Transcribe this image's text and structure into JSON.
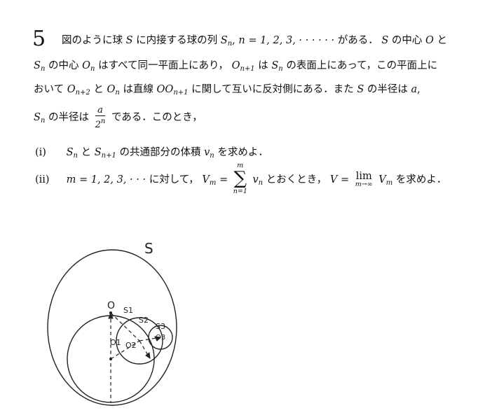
{
  "problem_number": "5",
  "p1": {
    "t1": "図のように球",
    "S": "S",
    "t2": "に内接する球の列",
    "Sn": "S",
    "n_sub": "n",
    "t3": ",",
    "seq": "n = 1, 2, 3, · · · · · ·",
    "t4": "がある．",
    "t5": "の中心",
    "O": "O",
    "t6": "と"
  },
  "p2": {
    "Sn": "S",
    "n": "n",
    "t1": "の中心",
    "On": "O",
    "t2": "はすべて同一平面上にあり，",
    "On1": "O",
    "n1": "n+1",
    "t3": "は",
    "t4": "の表面上にあって，この平面上に"
  },
  "p3": {
    "t1": "おいて",
    "On2": "O",
    "n2": "n+2",
    "t2": "と",
    "t3": "は直線",
    "OOn1": "OO",
    "t4": "に関して互いに反対側にある．また",
    "S": "S",
    "t5": "の半径は",
    "a": "a",
    "comma": ","
  },
  "p4": {
    "t1": "の半径は",
    "frac_num": "a",
    "frac_den": "2",
    "t2": "である．このとき，"
  },
  "q1": {
    "label": "(i)",
    "t1": "と",
    "t2": "の共通部分の体積",
    "v": "v",
    "t3": "を求めよ．"
  },
  "q2": {
    "label": "(ii)",
    "seq": "m = 1, 2, 3, · · ·",
    "t1": "に対して，",
    "Vm": "V",
    "eq": "=",
    "sum_top": "m",
    "sum_bot": "n=1",
    "t2": "とおくとき，",
    "V": "V",
    "lim": "lim",
    "lim_sub": "m→∞",
    "t3": "を求めよ．"
  },
  "figure": {
    "S": "S",
    "O": "O",
    "S1": "S1",
    "S2": "S2",
    "S3": "S3",
    "O1": "O1",
    "O2": "O2",
    "O3": "O3"
  }
}
